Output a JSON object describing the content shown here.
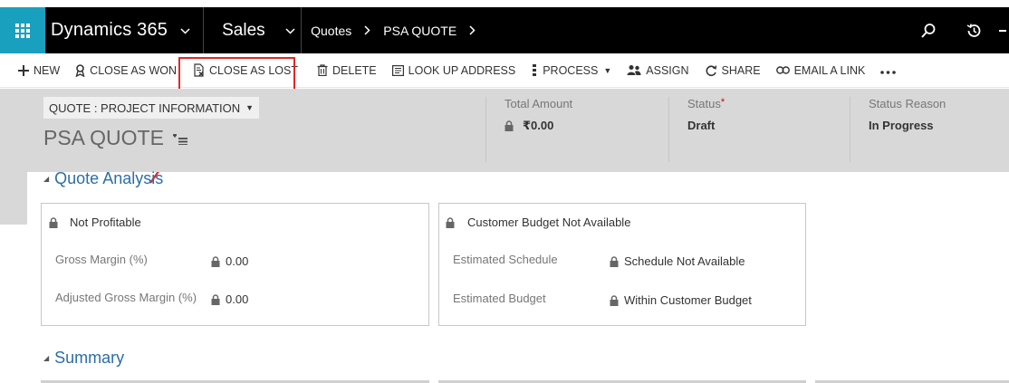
{
  "nav": {
    "brand": "Dynamics 365",
    "module": "Sales",
    "breadcrumb": [
      "Quotes",
      "PSA QUOTE"
    ]
  },
  "commands": [
    {
      "label": "NEW",
      "icon": "plus-icon"
    },
    {
      "label": "CLOSE AS WON",
      "icon": "award-icon"
    },
    {
      "label": "CLOSE AS LOST",
      "icon": "document-x-icon"
    },
    {
      "label": "DELETE",
      "icon": "trash-icon"
    },
    {
      "label": "LOOK UP ADDRESS",
      "icon": "address-book-icon"
    },
    {
      "label": "PROCESS",
      "icon": "process-icon"
    },
    {
      "label": "ASSIGN",
      "icon": "people-icon"
    },
    {
      "label": "SHARE",
      "icon": "share-icon"
    },
    {
      "label": "EMAIL A LINK",
      "icon": "link-icon"
    }
  ],
  "header": {
    "form_selector": "QUOTE : PROJECT INFORMATION",
    "record_title": "PSA QUOTE",
    "fields": {
      "total_amount": {
        "label": "Total Amount",
        "value": "₹0.00"
      },
      "status": {
        "label": "Status",
        "required": "*",
        "value": "Draft"
      },
      "status_reason": {
        "label": "Status Reason",
        "value": "In Progress"
      }
    }
  },
  "sections": {
    "quote_analysis": {
      "title": "Quote Analysis",
      "profitability": {
        "title": "Not Profitable",
        "gross_margin_label": "Gross Margin (%)",
        "gross_margin_value": "0.00",
        "adjusted_margin_label": "Adjusted Gross Margin (%)",
        "adjusted_margin_value": "0.00"
      },
      "budget": {
        "title": "Customer Budget Not Available",
        "schedule_label": "Estimated Schedule",
        "schedule_value": "Schedule Not Available",
        "budget_label": "Estimated Budget",
        "budget_value": "Within Customer Budget"
      }
    },
    "summary": {
      "title": "Summary"
    }
  },
  "colors": {
    "accent": "#1aa0bf",
    "nav_bg": "#000000",
    "highlight": "#e22727",
    "section_title": "#2c6ea5",
    "header_bg": "#d8d8d8"
  }
}
